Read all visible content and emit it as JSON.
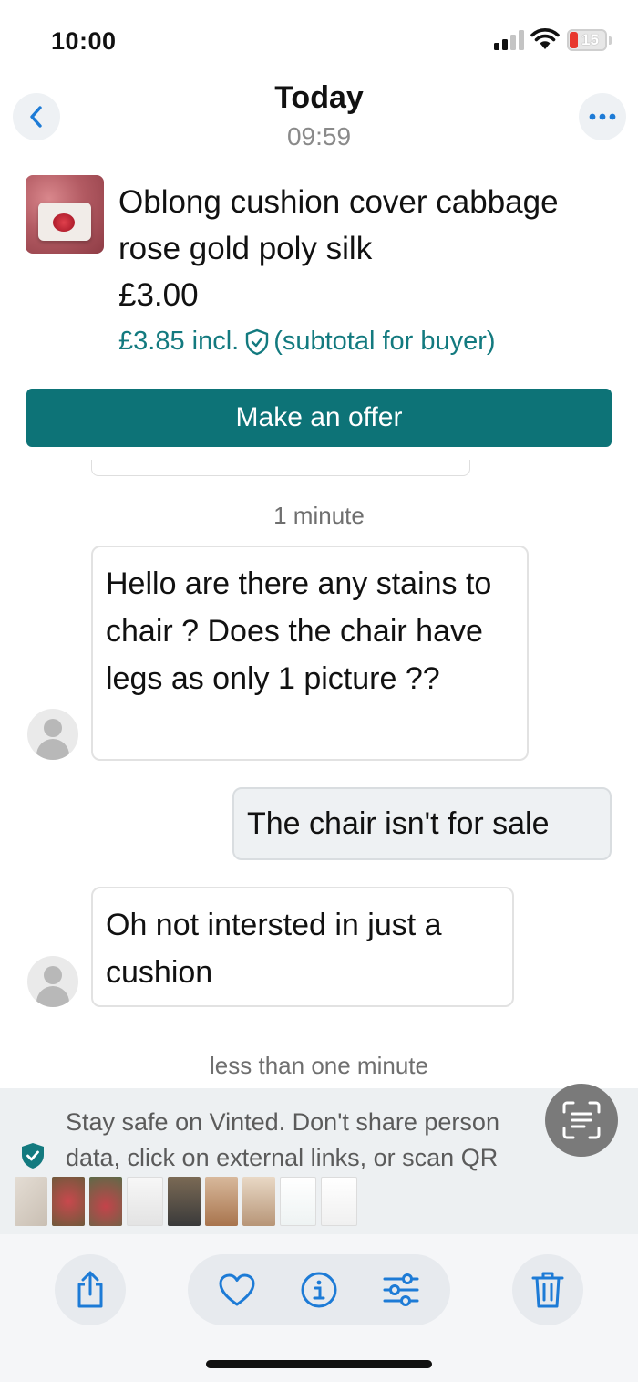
{
  "status_bar": {
    "time": "10:00",
    "battery": "15"
  },
  "header": {
    "title": "Today",
    "subtitle": "09:59",
    "back_icon": "chevron-left-icon",
    "more_icon": "ellipsis-icon"
  },
  "listing": {
    "title": "Oblong cushion cover cabbage rose gold poly silk",
    "price": "£3.00",
    "total_prefix": "£3.85 incl.",
    "total_suffix": "(subtotal for buyer)",
    "offer_button": "Make an offer"
  },
  "chat": {
    "timestamp_1": "1 minute",
    "messages": [
      {
        "from": "buyer",
        "text": "Hello are there any stains to chair ? Does the chair have legs as only 1 picture ??"
      },
      {
        "from": "seller",
        "text": "The chair isn't for sale"
      },
      {
        "from": "buyer",
        "text": "Oh not intersted in just a cushion"
      }
    ],
    "timestamp_2": "less than one minute"
  },
  "safety": {
    "line1": "Stay safe on Vinted. Don't share person",
    "line2": "data, click on external links, or scan QR",
    "link_fragment": "y s"
  },
  "toolbar": {
    "icons": [
      "share-icon",
      "heart-icon",
      "info-icon",
      "adjust-icon",
      "trash-icon"
    ]
  },
  "colors": {
    "accent": "#0d7377",
    "link": "#137a7f",
    "battery_low": "#e8382e"
  }
}
